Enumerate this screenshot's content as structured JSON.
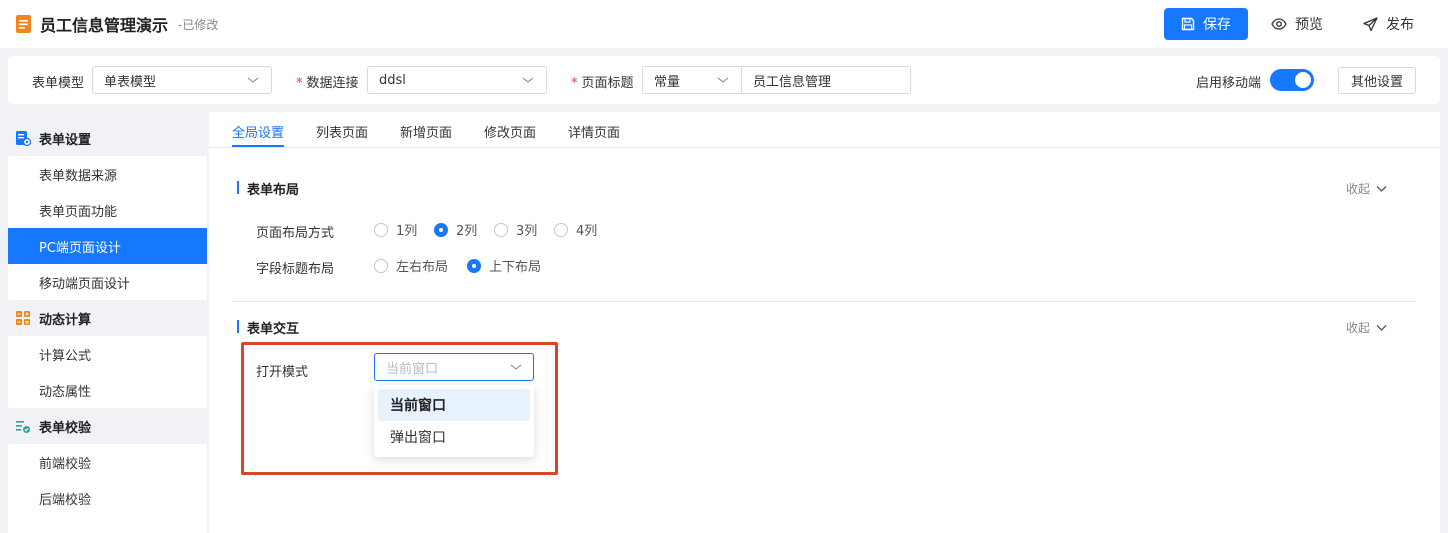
{
  "header": {
    "title": "员工信息管理演示",
    "status": "-已修改",
    "save_label": "保存",
    "preview_label": "预览",
    "publish_label": "发布"
  },
  "config": {
    "form_model_label": "表单模型",
    "form_model_value": "单表模型",
    "data_conn_label": "数据连接",
    "data_conn_value": "ddsl",
    "page_title_label": "页面标题",
    "page_title_type": "常量",
    "page_title_value": "员工信息管理",
    "mobile_label": "启用移动端",
    "mobile_enabled": true,
    "other_settings_label": "其他设置"
  },
  "sidebar": {
    "groups": [
      {
        "label": "表单设置",
        "items": [
          "表单数据来源",
          "表单页面功能",
          "PC端页面设计",
          "移动端页面设计"
        ]
      },
      {
        "label": "动态计算",
        "items": [
          "计算公式",
          "动态属性"
        ]
      },
      {
        "label": "表单校验",
        "items": [
          "前端校验",
          "后端校验"
        ]
      }
    ],
    "active_item": "PC端页面设计"
  },
  "tabs": [
    "全局设置",
    "列表页面",
    "新增页面",
    "修改页面",
    "详情页面"
  ],
  "active_tab": "全局设置",
  "layout_section": {
    "title": "表单布局",
    "collapse_label": "收起",
    "page_layout_label": "页面布局方式",
    "page_layout_options": [
      "1列",
      "2列",
      "3列",
      "4列"
    ],
    "page_layout_selected": "2列",
    "field_title_label": "字段标题布局",
    "field_title_options": [
      "左右布局",
      "上下布局"
    ],
    "field_title_selected": "上下布局"
  },
  "interaction_section": {
    "title": "表单交互",
    "collapse_label": "收起",
    "open_mode_label": "打开模式",
    "open_mode_placeholder": "当前窗口",
    "options": [
      "当前窗口",
      "弹出窗口"
    ],
    "highlighted_option": "当前窗口"
  },
  "colors": {
    "primary": "#1677ff",
    "highlight_border": "#d9452c",
    "app_icon": "#f0861e"
  }
}
